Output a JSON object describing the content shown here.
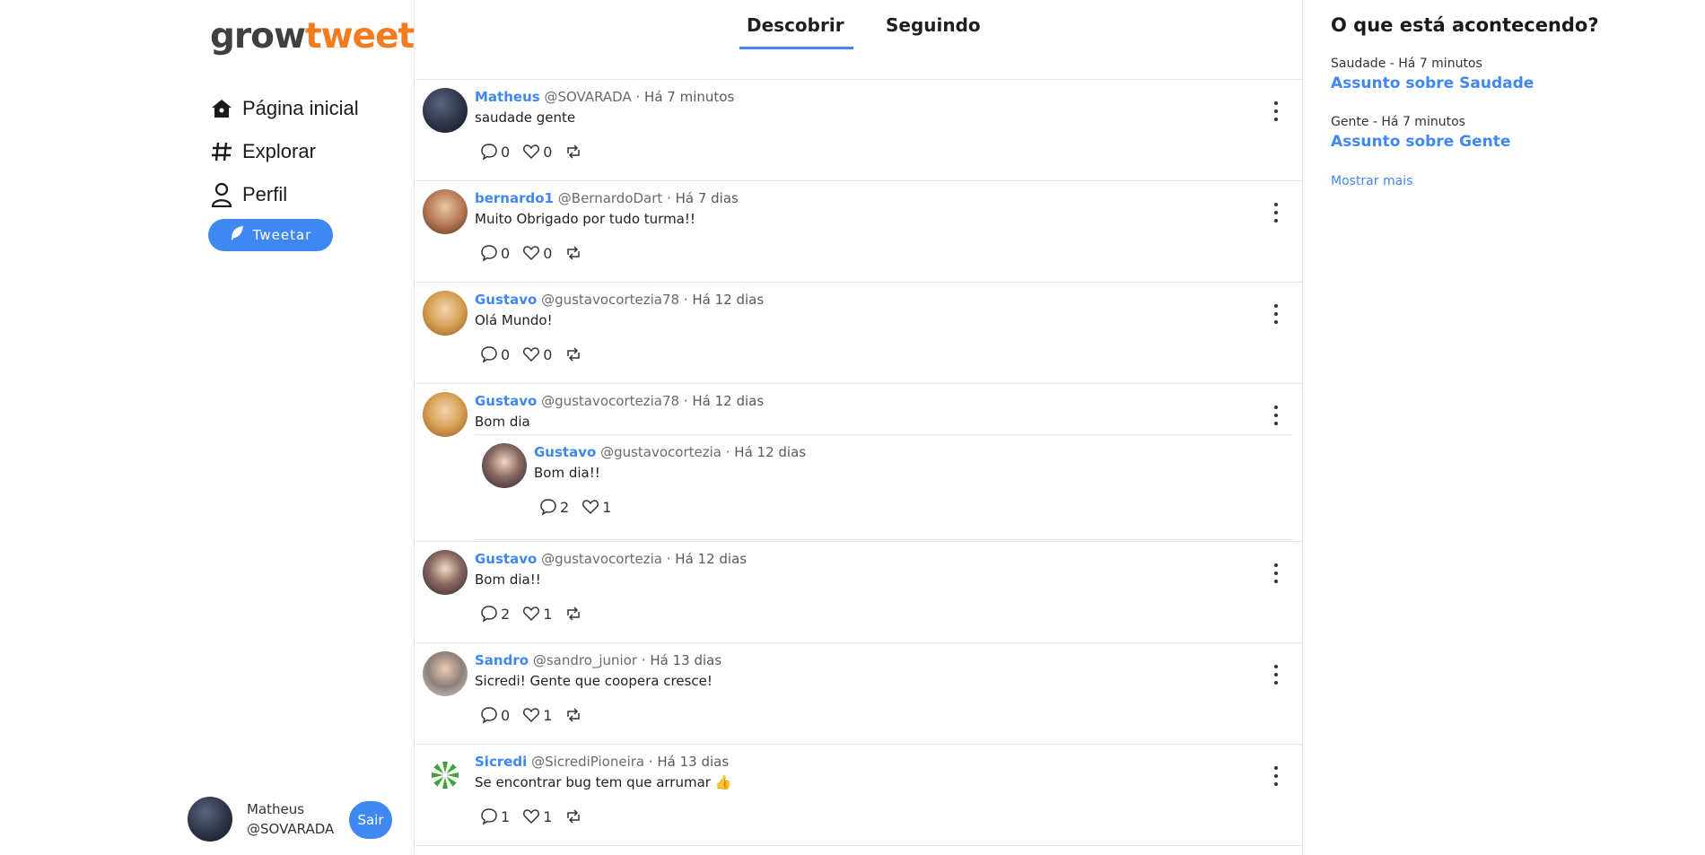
{
  "brand": {
    "logo_part1": "grow",
    "logo_part2": "tweet",
    "logo_color_1": "#404040",
    "logo_color_2": "#f47c20"
  },
  "accent_color": "#3f87f1",
  "nav": {
    "items": [
      {
        "label": "Página inicial",
        "icon": "home-icon"
      },
      {
        "label": "Explorar",
        "icon": "hashtag-icon"
      },
      {
        "label": "Perfil",
        "icon": "person-icon"
      }
    ],
    "tweet_button": "Tweetar"
  },
  "current_user": {
    "name": "Matheus",
    "handle": "@SOVARADA",
    "logout_label": "Sair"
  },
  "tabs": {
    "discover": "Descobrir",
    "following": "Seguindo"
  },
  "posts": [
    {
      "name": "Matheus",
      "handle": "@SOVARADA",
      "time": " · Há 7 minutos",
      "text": "saudade gente",
      "replies": "0",
      "likes": "0"
    },
    {
      "name": "bernardo1",
      "handle": "@BernardoDart",
      "time": " · Há 7 dias",
      "text": "Muito Obrigado por tudo turma!!",
      "replies": "0",
      "likes": "0"
    },
    {
      "name": "Gustavo",
      "handle": "@gustavocortezia78",
      "time": " · Há 12 dias",
      "text": "Olá Mundo!",
      "replies": "0",
      "likes": "0"
    },
    {
      "name": "Gustavo",
      "handle": "@gustavocortezia78",
      "time": " · Há 12 dias",
      "text": "Bom dia",
      "quoted": {
        "name": "Gustavo",
        "handle": "@gustavocortezia",
        "time": " · Há 12 dias",
        "text": "Bom dia!!",
        "replies": "2",
        "likes": "1"
      }
    },
    {
      "name": "Gustavo",
      "handle": "@gustavocortezia",
      "time": " · Há 12 dias",
      "text": "Bom dia!!",
      "replies": "2",
      "likes": "1"
    },
    {
      "name": "Sandro",
      "handle": "@sandro_junior",
      "time": " · Há 13 dias",
      "text": "Sicredi! Gente que coopera cresce!",
      "replies": "0",
      "likes": "1"
    },
    {
      "name": "Sicredi",
      "handle": "@SicrediPioneira",
      "time": " · Há 13 dias",
      "text": "Se encontrar bug tem que arrumar 👍",
      "replies": "1",
      "likes": "1"
    }
  ],
  "trends": {
    "title": "O que está acontecendo?",
    "items": [
      {
        "meta": "Saudade - Há 7 minutos",
        "topic": "Assunto sobre Saudade"
      },
      {
        "meta": "Gente - Há 7 minutos",
        "topic": "Assunto sobre Gente"
      }
    ],
    "show_more": "Mostrar mais"
  }
}
